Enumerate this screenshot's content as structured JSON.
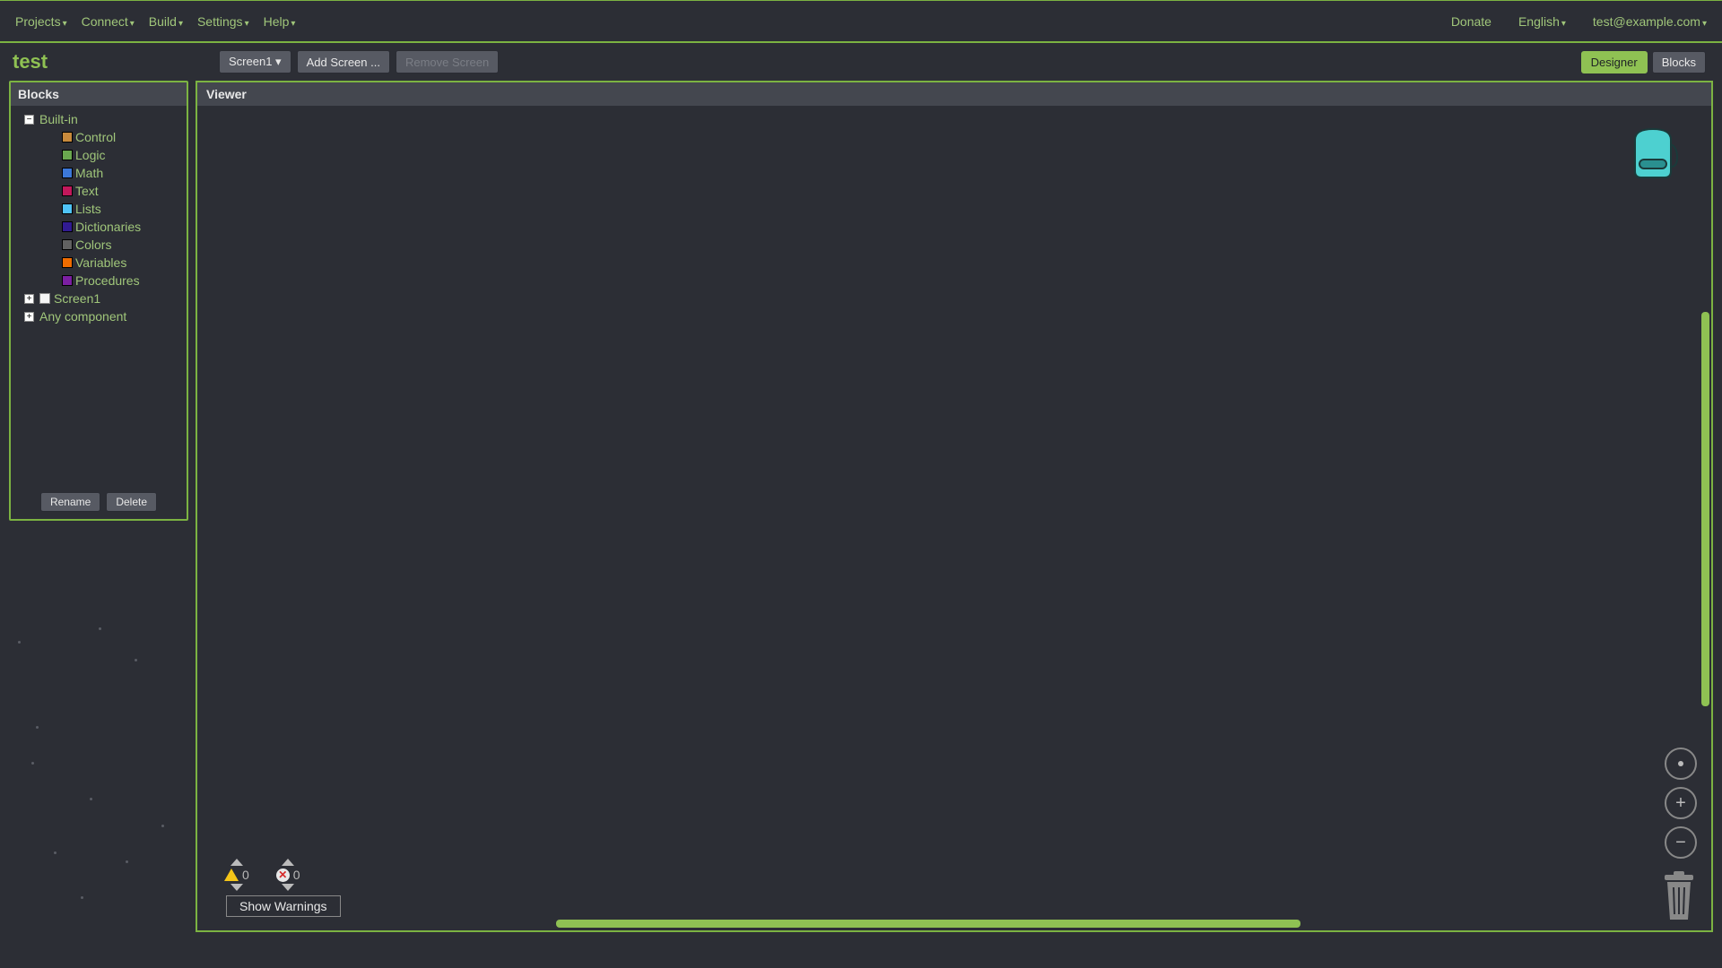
{
  "menu": {
    "left": [
      "Projects",
      "Connect",
      "Build",
      "Settings",
      "Help"
    ],
    "right": {
      "donate": "Donate",
      "language": "English",
      "user": "test@example.com"
    }
  },
  "project": {
    "title": "test",
    "screen_dropdown": "Screen1",
    "add_screen": "Add Screen ...",
    "remove_screen": "Remove Screen",
    "designer_btn": "Designer",
    "blocks_btn": "Blocks"
  },
  "panels": {
    "blocks_header": "Blocks",
    "viewer_header": "Viewer"
  },
  "tree": {
    "builtin_label": "Built-in",
    "items": [
      {
        "label": "Control",
        "color": "#c88a3c"
      },
      {
        "label": "Logic",
        "color": "#6aa84f"
      },
      {
        "label": "Math",
        "color": "#3c78d8"
      },
      {
        "label": "Text",
        "color": "#c2185b"
      },
      {
        "label": "Lists",
        "color": "#4fc3f7"
      },
      {
        "label": "Dictionaries",
        "color": "#311b92"
      },
      {
        "label": "Colors",
        "color": "#616161"
      },
      {
        "label": "Variables",
        "color": "#ef6c00"
      },
      {
        "label": "Procedures",
        "color": "#7b1fa2"
      }
    ],
    "screen_item": "Screen1",
    "any_component": "Any component",
    "rename_btn": "Rename",
    "delete_btn": "Delete"
  },
  "workspace": {
    "warning_count": "0",
    "error_count": "0",
    "show_warnings": "Show Warnings"
  }
}
